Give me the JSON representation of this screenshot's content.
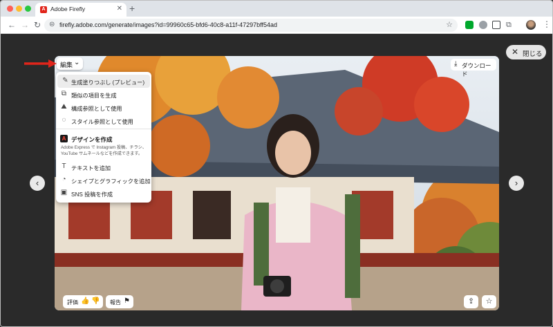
{
  "browser": {
    "tab_title": "Adobe Firefly",
    "tab_favicon_text": "A",
    "tab_close": "✕",
    "new_tab": "+",
    "url": "firefly.adobe.com/generate/images?id=99960c65-bfd6-40c8-a11f-47297bff54ad",
    "nav_back": "←",
    "nav_forward": "→",
    "nav_reload": "↻",
    "site_info": "⊜",
    "bookmark": "☆",
    "puzzle": "⧉",
    "more": "⋮"
  },
  "viewer": {
    "close_icon": "✕",
    "close_label": "閉じる",
    "prev_icon": "‹",
    "next_icon": "›",
    "edit_label": "編集",
    "edit_chevron": "⌄",
    "download_icon": "⤓",
    "download_label": "ダウンロード",
    "rate_label": "評価",
    "thumb_up": "👍",
    "thumb_down": "👎",
    "report_label": "報告",
    "flag_icon": "⚑",
    "share_icon": "⇪",
    "fav_icon": "☆"
  },
  "menu": {
    "items_top": [
      {
        "label": "生成塗りつぶし (プレビュー)",
        "icon": "✎"
      },
      {
        "label": "類似の項目を生成",
        "icon": "⧉"
      },
      {
        "label": "構成参照として使用",
        "icon": "⛰"
      },
      {
        "label": "スタイル参照として使用",
        "icon": "◌"
      }
    ],
    "design": {
      "label": "デザインを作成",
      "adobe_letter": "A",
      "description": "Adobe Express で Instagram 投稿、チラシ、YouTube サムネールなどを作成できます。"
    },
    "items_bottom": [
      {
        "label": "テキストを追加",
        "icon": "T"
      },
      {
        "label": "シェイプとグラフィックを追加",
        "icon": "◔"
      },
      {
        "label": "SNS 投稿を作成",
        "icon": "▣"
      }
    ]
  },
  "colors": {
    "accent_red": "#e1251b",
    "backdrop": "#2a2a2a"
  }
}
